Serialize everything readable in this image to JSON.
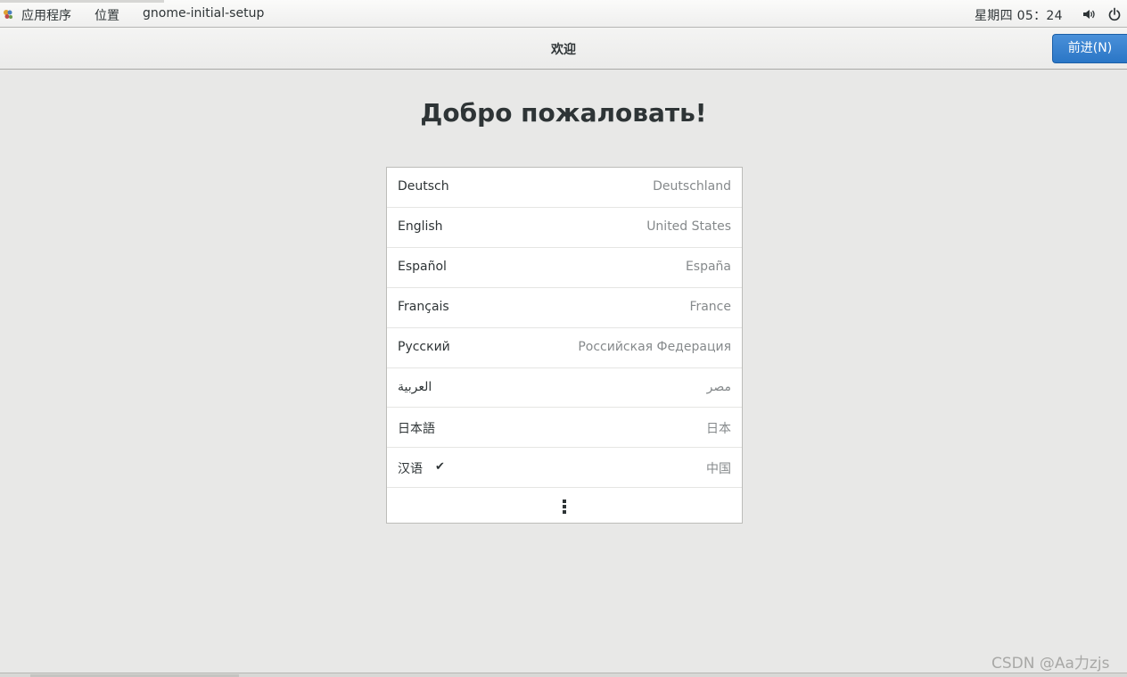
{
  "top_bar": {
    "menus": [
      "应用程序",
      "位置",
      "gnome-initial-setup"
    ],
    "clock": "星期四 05：24",
    "icons": [
      "app-menu-icon",
      "volume-icon",
      "power-icon"
    ]
  },
  "header": {
    "title": "欢迎",
    "next_button": "前进(N)"
  },
  "main": {
    "welcome": "Добро пожаловать!",
    "languages": [
      {
        "name": "Deutsch",
        "region": "Deutschland",
        "selected": false
      },
      {
        "name": "English",
        "region": "United States",
        "selected": false
      },
      {
        "name": "Español",
        "region": "España",
        "selected": false
      },
      {
        "name": "Français",
        "region": "France",
        "selected": false
      },
      {
        "name": "Русский",
        "region": "Российская Федерация",
        "selected": false
      },
      {
        "name": "العربية",
        "region": "مصر",
        "selected": false
      },
      {
        "name": "日本語",
        "region": "日本",
        "selected": false
      },
      {
        "name": "汉语",
        "region": "中国",
        "selected": true
      }
    ],
    "check_mark": "✔",
    "more_icon": "more-vertical-icon"
  },
  "watermark": "CSDN @Aa力zjs",
  "colors": {
    "accent": "#3584e4",
    "background": "#e8e8e7",
    "list_bg": "#ffffff",
    "secondary_text": "#85898b"
  }
}
